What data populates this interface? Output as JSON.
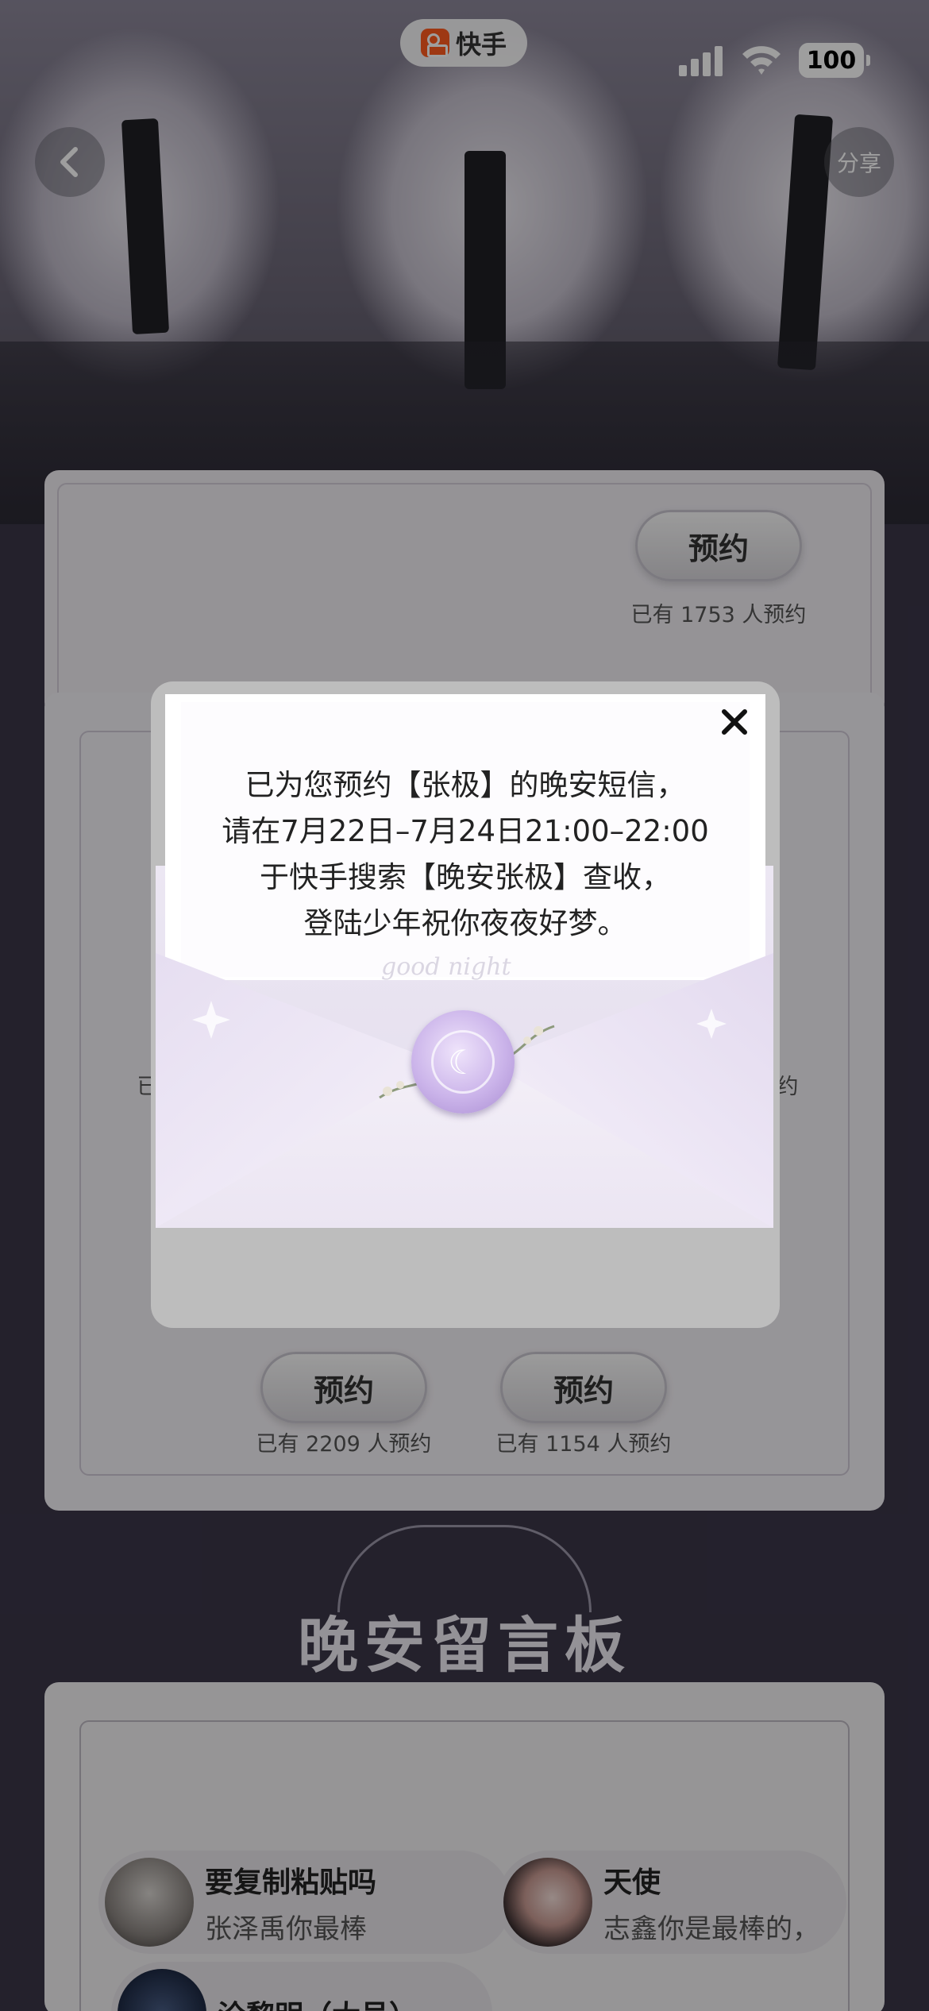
{
  "status_bar": {
    "app_name": "快手",
    "battery": "100"
  },
  "header": {
    "back_icon": "chevron-left-icon",
    "share_label": "分享"
  },
  "top_card": {
    "reserve_label": "预约",
    "reserve_count": "已有 1753 人预约"
  },
  "middle_card": {
    "left_count_partial": "已",
    "right_count_partial": "约",
    "items": [
      {
        "reserve_label": "预约",
        "reserve_count": "已有 2209 人预约"
      },
      {
        "reserve_label": "预约",
        "reserve_count": "已有 1154 人预约"
      }
    ]
  },
  "message_board": {
    "title": "晚安留言板",
    "messages": [
      {
        "name": "要复制粘贴吗",
        "text": "张泽禹你最棒"
      },
      {
        "name": "天使",
        "text": "志鑫你是最棒的，"
      },
      {
        "name": "沧黎明（大号）",
        "text": ""
      }
    ]
  },
  "modal": {
    "lines": [
      "已为您预约【张极】的晚安短信，",
      "请在7月22日–7月24日21:00–22:00",
      "于快手搜索【晚安张极】查收，",
      "登陆少年祝你夜夜好梦。"
    ],
    "decoration": "good night",
    "close_icon": "close-icon",
    "seal_icon": "moon-seal-icon"
  },
  "colors": {
    "accent_red": "#e4325a",
    "seal_purple": "#cbb4ea",
    "brand_orange": "#ff5b1f"
  }
}
